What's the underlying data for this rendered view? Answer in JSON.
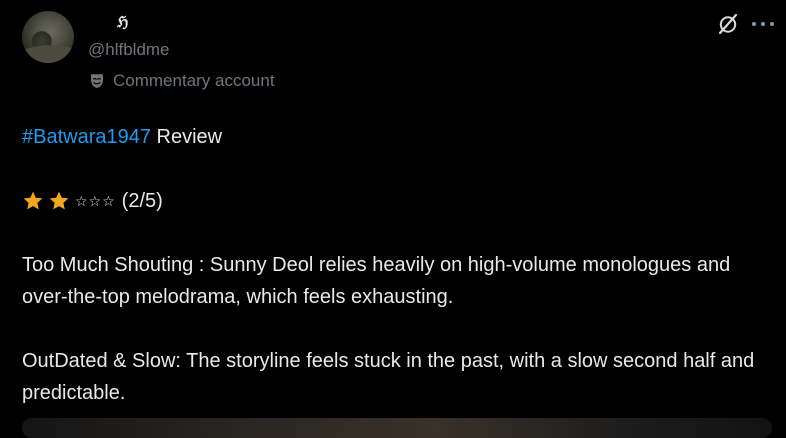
{
  "post": {
    "display_name": "ℌ",
    "handle": "@hlfbldme",
    "account_label": "Commentary account",
    "hashtag": "#Batwara1947",
    "title_rest": " Review",
    "rating_outline_stars": "☆☆☆",
    "rating_text": "(2/5)",
    "rating_value": 2,
    "rating_max": 5,
    "paragraph1": "Too Much Shouting : Sunny Deol relies heavily on high-volume monologues and over-the-top melodrama, which feels exhausting.",
    "paragraph2": "OutDated & Slow: The storyline feels stuck in the past, with a slow second half and predictable."
  },
  "colors": {
    "background": "#000000",
    "text": "#e7e9ea",
    "muted": "#71767b",
    "link": "#1d9bf0",
    "star": "#f4a623"
  },
  "icons": {
    "label": "mask-icon",
    "header_action": "grok-icon",
    "menu": "more-icon"
  }
}
